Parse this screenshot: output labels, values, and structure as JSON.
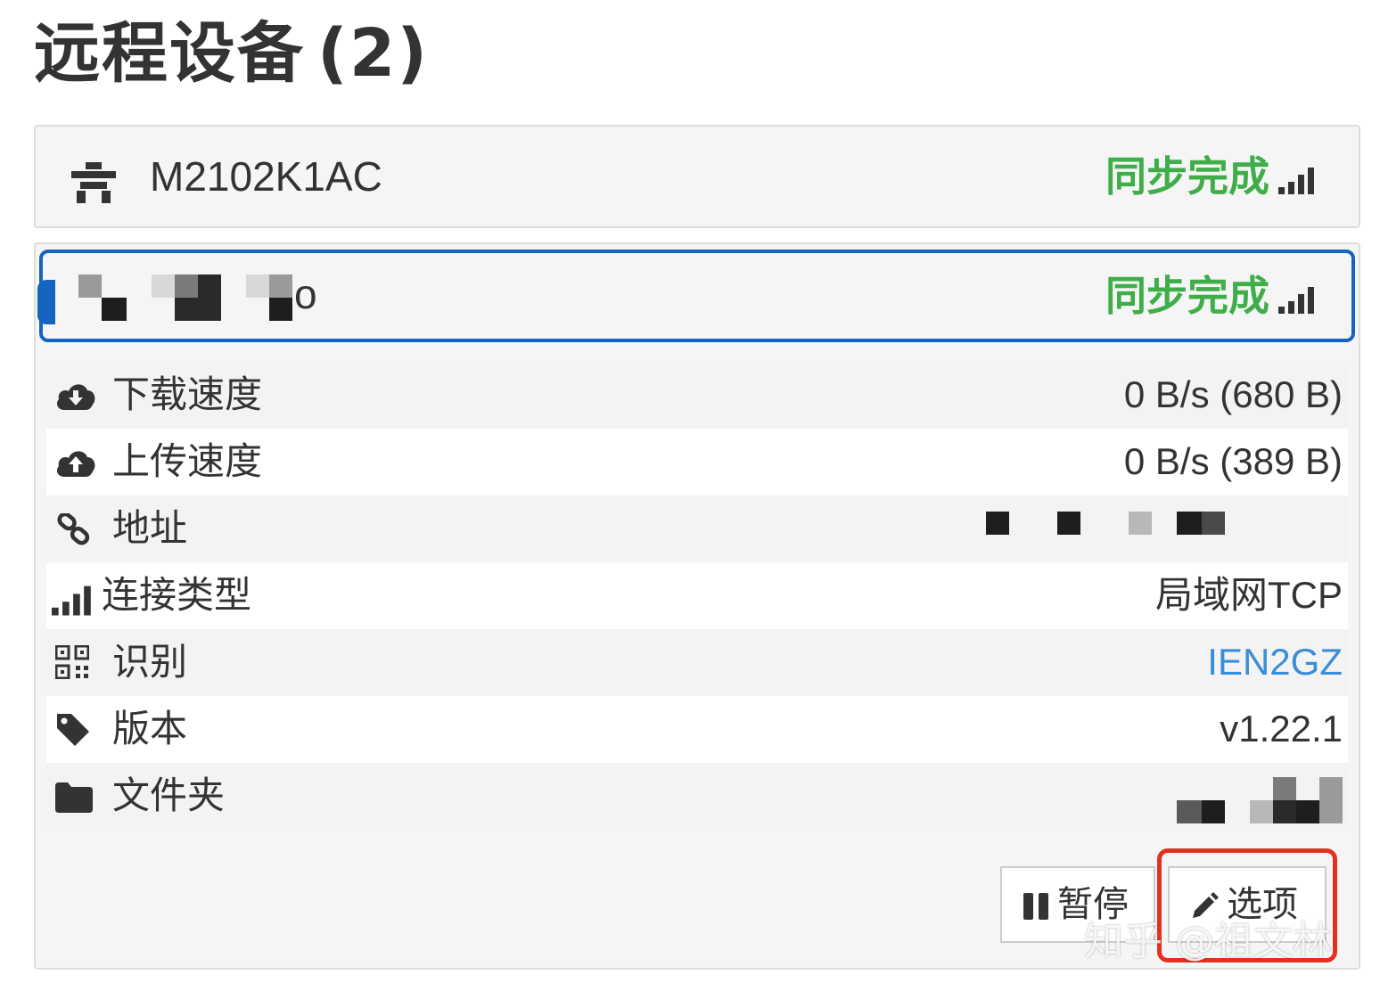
{
  "page": {
    "title": "远程设备",
    "count": "(2)"
  },
  "devices": [
    {
      "name": "M2102K1AC",
      "status": "同步完成"
    },
    {
      "name": "o",
      "status": "同步完成",
      "details": [
        {
          "icon": "cloud-download-icon",
          "label": "下载速度",
          "value": "0 B/s (680 B)"
        },
        {
          "icon": "cloud-upload-icon",
          "label": "上传速度",
          "value": "0 B/s (389 B)"
        },
        {
          "icon": "link-icon",
          "label": "地址",
          "value": ""
        },
        {
          "icon": "signal-icon",
          "label": "连接类型",
          "value": "局域网TCP"
        },
        {
          "icon": "qrcode-icon",
          "label": "识别",
          "value": "IEN2GZ"
        },
        {
          "icon": "tag-icon",
          "label": "版本",
          "value": "v1.22.1"
        },
        {
          "icon": "folder-icon",
          "label": "文件夹",
          "value": ""
        }
      ],
      "actions": {
        "pause_label": "暂停",
        "options_label": "选项"
      }
    }
  ],
  "watermark": "知乎 @祖文林",
  "colors": {
    "status_green": "#3fae49",
    "focus_blue": "#1565c0",
    "link_blue": "#3a8ed8",
    "highlight_red": "#e53020"
  }
}
